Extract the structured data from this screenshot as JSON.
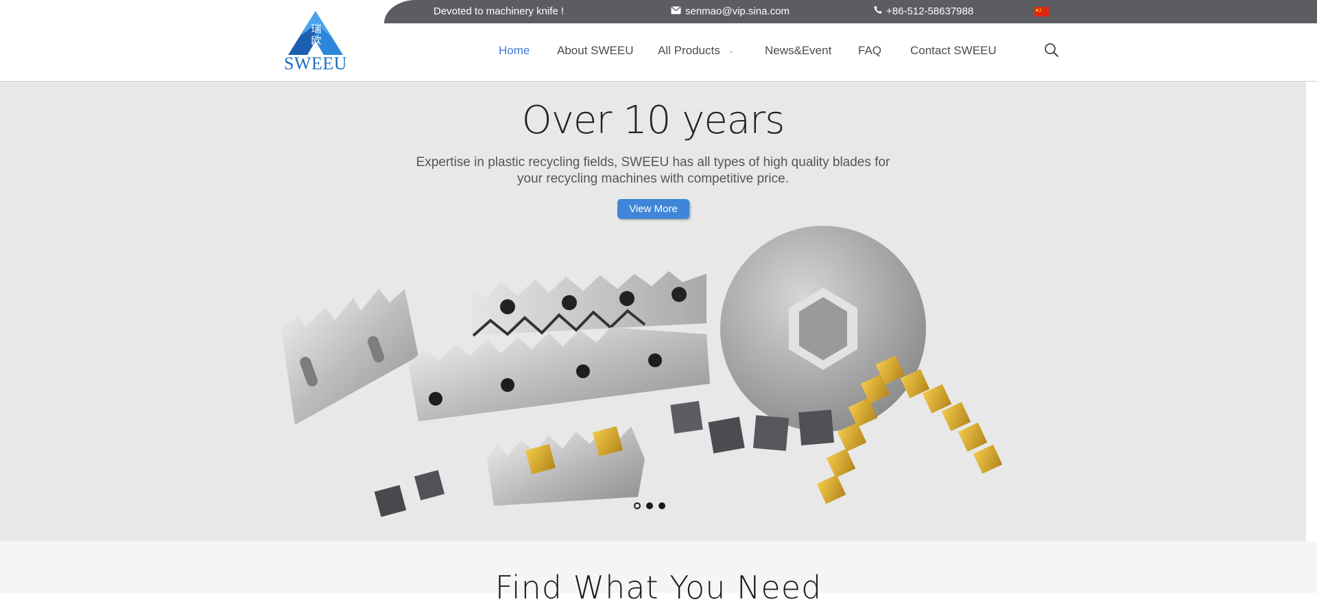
{
  "topbar": {
    "tagline": "Devoted to machinery knife !",
    "email": "senmao@vip.sina.com",
    "phone": "+86-512-58637988",
    "email_icon": "envelope-icon",
    "phone_icon": "phone-icon",
    "flag_icon": "china-flag-icon",
    "bar_color": "#5c5d62"
  },
  "logo": {
    "brand": "SWEEU",
    "chinese": "瑞欧"
  },
  "nav": {
    "items": [
      {
        "label": "Home",
        "active": true
      },
      {
        "label": "About SWEEU"
      },
      {
        "label": "All Products"
      },
      {
        "label": "News&Event"
      },
      {
        "label": "FAQ"
      },
      {
        "label": "Contact SWEEU"
      }
    ],
    "search_icon": "search-icon",
    "active_color": "#3a7bd5"
  },
  "hero": {
    "title": "Over 10 years",
    "subtitle": "Expertise in plastic recycling fields, SWEEU has all types of high quality blades for your recycling machines with competitive price.",
    "button_label": "View More",
    "button_color": "#3f86d8",
    "slide_count": 3,
    "active_slide": 1
  },
  "find": {
    "title": "Find What You Need"
  }
}
